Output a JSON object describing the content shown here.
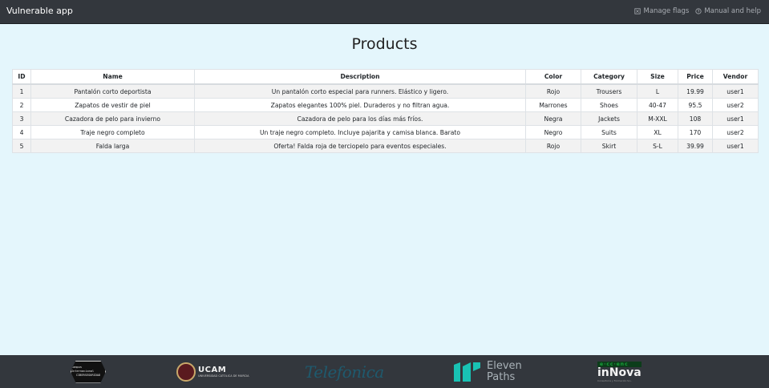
{
  "navbar": {
    "brand": "Vulnerable app",
    "links": [
      {
        "label": "Manage flags",
        "icon": "flag-box-icon"
      },
      {
        "label": "Manual and help",
        "icon": "help-circle-icon"
      }
    ]
  },
  "page": {
    "title": "Products"
  },
  "table": {
    "headers": [
      "ID",
      "Name",
      "Description",
      "Color",
      "Category",
      "Size",
      "Price",
      "Vendor"
    ],
    "rows": [
      [
        "1",
        "Pantalón corto deportista",
        "Un pantalón corto especial para runners. Elástico y ligero.",
        "Rojo",
        "Trousers",
        "L",
        "19.99",
        "user1"
      ],
      [
        "2",
        "Zapatos de vestir de piel",
        "Zapatos elegantes 100% piel. Duraderos y no filtran agua.",
        "Marrones",
        "Shoes",
        "40-47",
        "95.5",
        "user2"
      ],
      [
        "3",
        "Cazadora de pelo para invierno",
        "Cazadora de pelo para los días más fríos.",
        "Negra",
        "Jackets",
        "M-XXL",
        "108",
        "user1"
      ],
      [
        "4",
        "Traje negro completo",
        "Un traje negro completo. Incluye pajarita y camisa blanca. Barato",
        "Negro",
        "Suits",
        "XL",
        "170",
        "user2"
      ],
      [
        "5",
        "Falda larga",
        "Oferta! Falda roja de terciopelo para eventos especiales.",
        "Rojo",
        "Skirt",
        "S-L",
        "39.99",
        "user1"
      ]
    ]
  },
  "footer": {
    "logos": [
      {
        "name": "Campus Internacional Ciberseguridad",
        "text_lines": [
          "Campus Internacional",
          "CIBERSEGURIDAD"
        ]
      },
      {
        "name": "UCAM",
        "big": "UCAM",
        "small": "UNIVERSIDAD CATÓLICA DE MURCIA"
      },
      {
        "name": "Telefonica",
        "text": "Telefonica"
      },
      {
        "name": "Eleven Paths",
        "line1": "Eleven",
        "line2": "Paths"
      },
      {
        "name": "Innova",
        "top": "e·cc·enc",
        "main": "inNova",
        "sub": "Consultoría y Formación S.L."
      }
    ]
  },
  "colors": {
    "navbar_bg": "#33373d",
    "page_bg": "#e4f6fc",
    "stripe": "#f2f2f2",
    "eleven_paths_teal": "#19c2b4"
  }
}
